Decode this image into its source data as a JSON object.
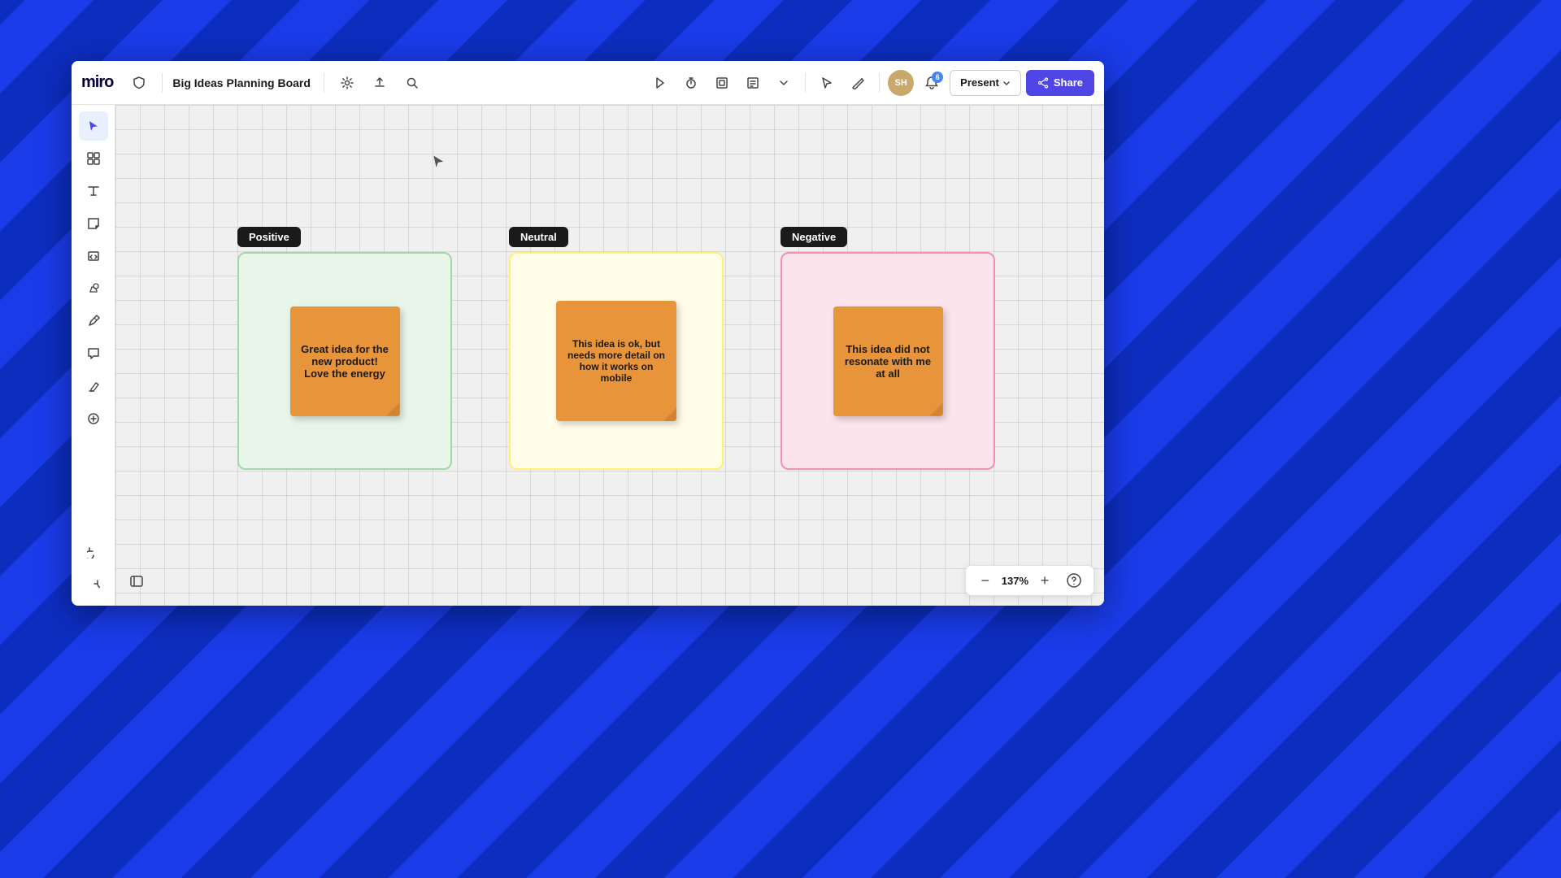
{
  "app": {
    "name": "miro",
    "board_title": "Big Ideas Planning Board"
  },
  "toolbar": {
    "left_icons": [
      "shield-icon",
      "settings-icon",
      "upload-icon",
      "search-icon"
    ],
    "center_icons": [
      "play-icon",
      "timer-icon",
      "frame-icon",
      "notes-icon",
      "chevron-down-icon"
    ],
    "right_icons": [
      "cursor-select-icon",
      "draw-icon"
    ],
    "avatar_initials": "SH",
    "notification_count": "6",
    "present_label": "Present",
    "share_label": "Share"
  },
  "sidebar": {
    "items": [
      {
        "name": "select-tool",
        "icon": "cursor-arrow",
        "active": true
      },
      {
        "name": "frames-tool",
        "icon": "grid-icon",
        "active": false
      },
      {
        "name": "text-tool",
        "icon": "text-T",
        "active": false
      },
      {
        "name": "sticky-tool",
        "icon": "sticky-note",
        "active": false
      },
      {
        "name": "embed-tool",
        "icon": "image-square",
        "active": false
      },
      {
        "name": "shapes-tool",
        "icon": "shapes",
        "active": false
      },
      {
        "name": "pen-tool",
        "icon": "pen-line",
        "active": false
      },
      {
        "name": "comment-tool",
        "icon": "comment-bubble",
        "active": false
      },
      {
        "name": "text-tool-2",
        "icon": "highlighter",
        "active": false
      },
      {
        "name": "add-tool",
        "icon": "plus-circle",
        "active": false
      }
    ]
  },
  "columns": [
    {
      "id": "positive",
      "label": "Positive",
      "bg_class": "positive",
      "sticky": {
        "text": "Great idea for the new product! Love the energy",
        "color": "orange"
      }
    },
    {
      "id": "neutral",
      "label": "Neutral",
      "bg_class": "neutral",
      "sticky": {
        "text": "This idea is ok, but needs more detail on how it works on mobile",
        "color": "orange"
      }
    },
    {
      "id": "negative",
      "label": "Negative",
      "bg_class": "negative",
      "sticky": {
        "text": "This idea did not resonate with me at all",
        "color": "orange"
      }
    }
  ],
  "zoom": {
    "level": "137%",
    "minus_label": "−",
    "plus_label": "+"
  },
  "help": {
    "label": "?"
  }
}
